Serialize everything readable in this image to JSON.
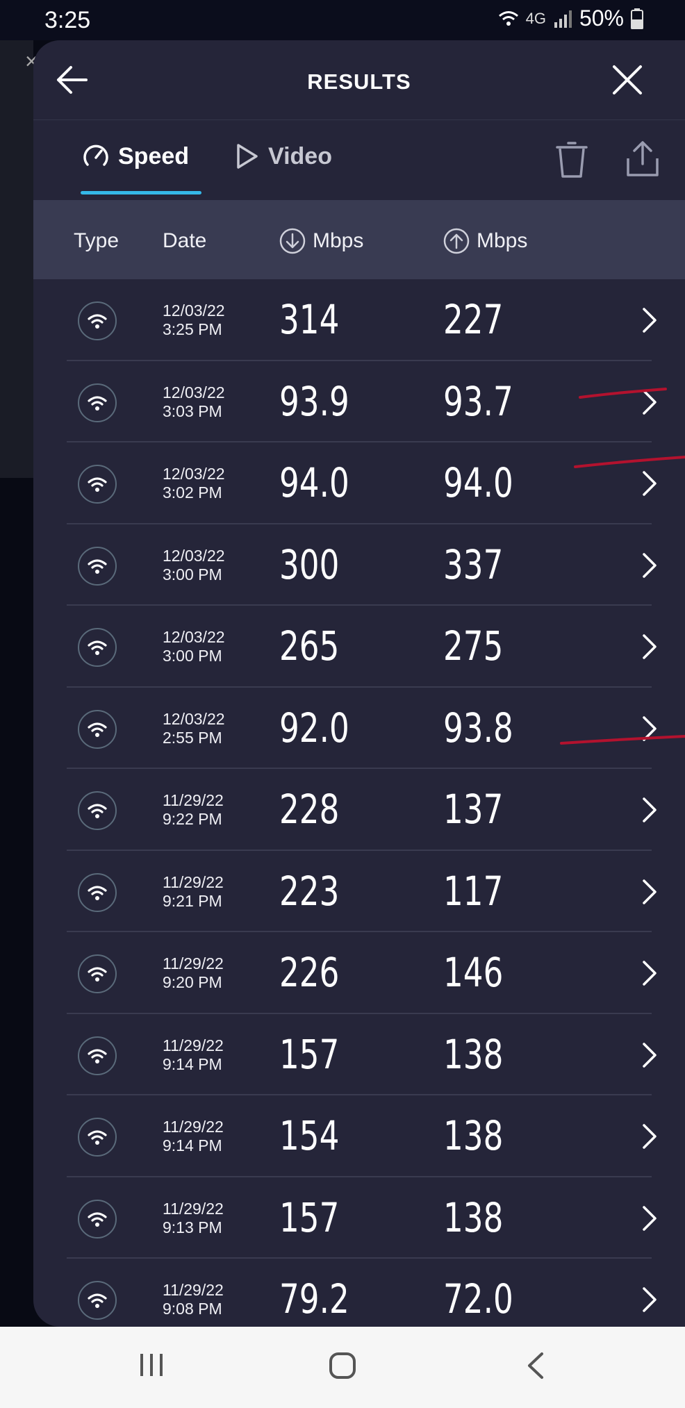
{
  "status_bar": {
    "time": "3:25",
    "network": "4G",
    "battery": "50%"
  },
  "header": {
    "title": "RESULTS",
    "back_icon": "arrow-left-icon",
    "close_icon": "close-icon"
  },
  "tabs": [
    {
      "label": "Speed",
      "icon": "speedometer-icon",
      "active": true
    },
    {
      "label": "Video",
      "icon": "play-icon",
      "active": false
    }
  ],
  "toolbar": {
    "delete_icon": "trash-icon",
    "share_icon": "share-icon"
  },
  "columns": {
    "type": "Type",
    "date": "Date",
    "download": "Mbps",
    "upload": "Mbps"
  },
  "rows": [
    {
      "date": "12/03/22",
      "time": "3:25 PM",
      "download": "314",
      "upload": "227"
    },
    {
      "date": "12/03/22",
      "time": "3:03 PM",
      "download": "93.9",
      "upload": "93.7"
    },
    {
      "date": "12/03/22",
      "time": "3:02 PM",
      "download": "94.0",
      "upload": "94.0"
    },
    {
      "date": "12/03/22",
      "time": "3:00 PM",
      "download": "300",
      "upload": "337"
    },
    {
      "date": "12/03/22",
      "time": "3:00 PM",
      "download": "265",
      "upload": "275"
    },
    {
      "date": "12/03/22",
      "time": "2:55 PM",
      "download": "92.0",
      "upload": "93.8"
    },
    {
      "date": "11/29/22",
      "time": "9:22 PM",
      "download": "228",
      "upload": "137"
    },
    {
      "date": "11/29/22",
      "time": "9:21 PM",
      "download": "223",
      "upload": "117"
    },
    {
      "date": "11/29/22",
      "time": "9:20 PM",
      "download": "226",
      "upload": "146"
    },
    {
      "date": "11/29/22",
      "time": "9:14 PM",
      "download": "157",
      "upload": "138"
    },
    {
      "date": "11/29/22",
      "time": "9:14 PM",
      "download": "154",
      "upload": "138"
    },
    {
      "date": "11/29/22",
      "time": "9:13 PM",
      "download": "157",
      "upload": "138"
    },
    {
      "date": "11/29/22",
      "time": "9:08 PM",
      "download": "79.2",
      "upload": "72.0"
    }
  ],
  "colors": {
    "accent": "#35b8e8",
    "panel": "#252539",
    "header_band": "#393b52",
    "annotation": "#b3122e"
  }
}
